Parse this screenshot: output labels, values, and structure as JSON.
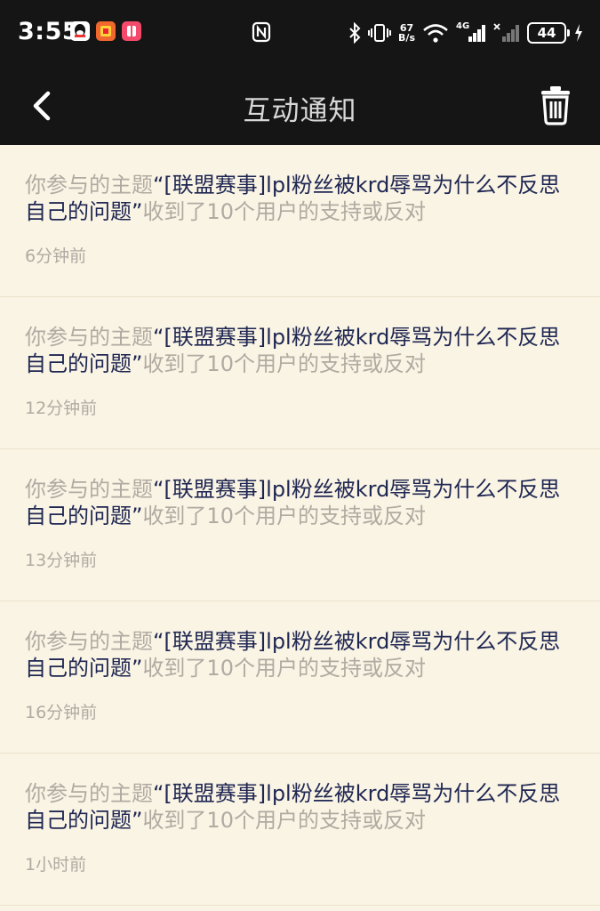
{
  "status_bar": {
    "time": "3:55",
    "net_speed_value": "67",
    "net_speed_unit": "B/s",
    "network_type": "4G",
    "battery_level": "44",
    "icons": [
      "qq-icon",
      "app-icon",
      "app-icon-2",
      "nfc-icon",
      "bluetooth-icon",
      "vibrate-icon",
      "wifi-icon",
      "signal-icon",
      "signal-icon-no-service",
      "battery-icon",
      "charging-icon"
    ]
  },
  "header": {
    "title": "互动通知",
    "back_icon": "chevron-left-icon",
    "delete_icon": "trash-icon"
  },
  "notifications": [
    {
      "prefix": "你参与的主题",
      "topic": "“[联盟赛事]lpl粉丝被krd辱骂为什么不反思自己的问题”",
      "suffix": "收到了10个用户的支持或反对",
      "time": "6分钟前"
    },
    {
      "prefix": "你参与的主题",
      "topic": "“[联盟赛事]lpl粉丝被krd辱骂为什么不反思自己的问题”",
      "suffix": "收到了10个用户的支持或反对",
      "time": "12分钟前"
    },
    {
      "prefix": "你参与的主题",
      "topic": "“[联盟赛事]lpl粉丝被krd辱骂为什么不反思自己的问题”",
      "suffix": "收到了10个用户的支持或反对",
      "time": "13分钟前"
    },
    {
      "prefix": "你参与的主题",
      "topic": "“[联盟赛事]lpl粉丝被krd辱骂为什么不反思自己的问题”",
      "suffix": "收到了10个用户的支持或反对",
      "time": "16分钟前"
    },
    {
      "prefix": "你参与的主题",
      "topic": "“[联盟赛事]lpl粉丝被krd辱骂为什么不反思自己的问题”",
      "suffix": "收到了10个用户的支持或反对",
      "time": "1小时前"
    }
  ],
  "colors": {
    "header_bg": "#151515",
    "page_bg": "#faf4e4",
    "muted_text": "#b0aaa2",
    "topic_text": "#1e2652"
  }
}
